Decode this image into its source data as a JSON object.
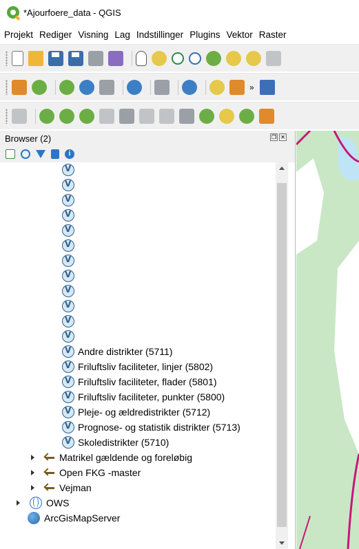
{
  "window": {
    "title": "*Ajourfoere_data - QGIS"
  },
  "menu": [
    "Projekt",
    "Rediger",
    "Visning",
    "Lag",
    "Indstillinger",
    "Plugins",
    "Vektor",
    "Raster"
  ],
  "toolbar": {
    "row1": [
      "new-project-icon",
      "open-project-icon",
      "save-project-icon",
      "save-as-icon",
      "print-layout-icon",
      "style-manager-icon",
      "pan-icon",
      "pan-to-selection-icon",
      "zoom-in-icon",
      "zoom-out-icon",
      "zoom-full-icon",
      "zoom-to-selection-icon",
      "zoom-to-layer-icon",
      "zoom-native-icon"
    ],
    "row2": [
      "digitize-icon",
      "plugin-icon",
      "new-vector-icon",
      "edit-pencil-icon",
      "gps-icon",
      "processing-icon",
      "database-icon",
      "web-icon",
      "python-icon",
      "layers-icon",
      "help-icon"
    ],
    "row2_more": "»",
    "row3": [
      "select-icon",
      "add-feature-icon",
      "node-tool-icon",
      "move-feature-icon",
      "delete-feature-icon",
      "cut-icon",
      "copy-icon",
      "paste-icon",
      "split-icon",
      "reshape-icon",
      "offset-icon",
      "advanced-digitize-icon",
      "scissors-icon"
    ]
  },
  "browser": {
    "title": "Browser (2)",
    "panel_buttons": [
      "❐",
      "✕"
    ],
    "info_glyph": "i",
    "unnamed_layer_count": 12,
    "named_layers": [
      "Andre distrikter (5711)",
      "Friluftsliv faciliteter,  linjer (5802)",
      "Friluftsliv faciliteter, flader (5801)",
      "Friluftsliv faciliteter, punkter (5800)",
      "Pleje- og ældredistrikter (5712)",
      "Prognose- og statistik distrikter (5713)",
      "Skoledistrikter (5710)"
    ],
    "connections": [
      "Matrikel gældende og foreløbig",
      "Open FKG -master",
      "Vejman"
    ],
    "ows": "OWS",
    "arcgis": "ArcGisMapServer"
  },
  "colors": {
    "map_green": "#c9e7c5",
    "map_white": "#ffffff",
    "road_magenta": "#c8167a",
    "water_blue": "#bfe4f5"
  }
}
